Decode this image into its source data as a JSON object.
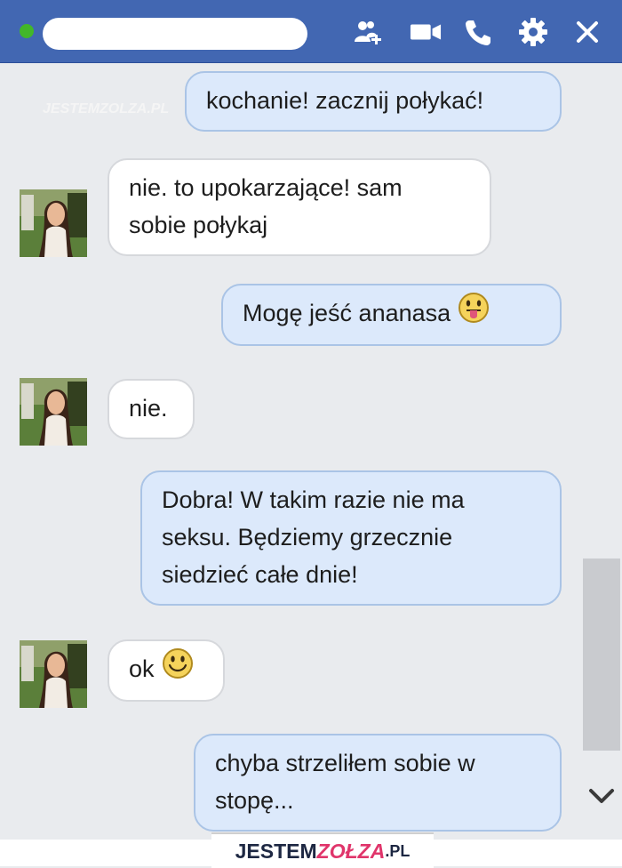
{
  "header": {
    "status": "online",
    "icons": [
      "add-friend-icon",
      "video-call-icon",
      "phone-icon",
      "gear-icon",
      "close-icon"
    ]
  },
  "watermark": "JESTEMZOLZA.PL",
  "messages": [
    {
      "from": "me",
      "text": "kochanie! zacznij połykać!"
    },
    {
      "from": "them",
      "lines": [
        "nie. to upokarzające! sam",
        "sobie połykaj"
      ]
    },
    {
      "from": "me",
      "text": "Mogę jeść ananasa",
      "emoji": "tongue-out-emoji"
    },
    {
      "from": "them",
      "text": "nie."
    },
    {
      "from": "me",
      "lines": [
        "Dobra! W takim razie nie ma",
        "seksu. Będziemy grzecznie",
        "siedzieć całe dnie!"
      ]
    },
    {
      "from": "them",
      "text": "ok",
      "emoji": "smile-emoji"
    },
    {
      "from": "me",
      "lines": [
        "chyba strzeliłem sobie w",
        "stopę..."
      ]
    }
  ],
  "logo": {
    "part1": "JESTEM",
    "part2": "ZOŁZA",
    "part3": ".PL"
  },
  "colors": {
    "header": "#4267b2",
    "my_bubble": "#dce9fb",
    "their_bubble": "#ffffff",
    "background": "#e9ebee"
  }
}
